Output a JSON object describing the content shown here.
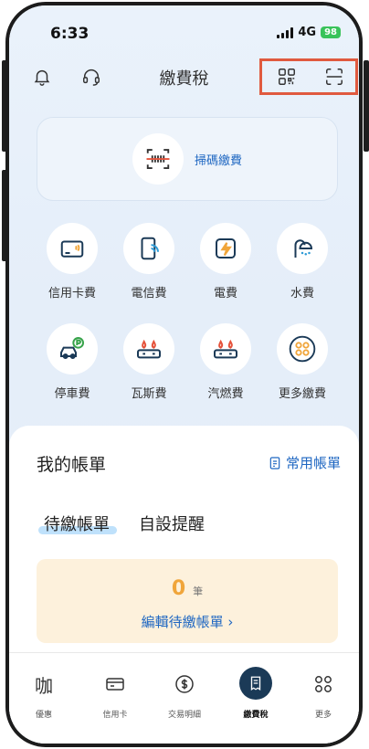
{
  "status_bar": {
    "time": "6:33",
    "network": "4G",
    "battery": "98"
  },
  "header": {
    "title": "繳費稅"
  },
  "scan_card": {
    "label": "掃碼繳費"
  },
  "services": [
    {
      "label": "信用卡費",
      "icon": "credit-card-icon"
    },
    {
      "label": "電信費",
      "icon": "phone-wifi-icon"
    },
    {
      "label": "電費",
      "icon": "lightning-icon"
    },
    {
      "label": "水費",
      "icon": "shower-icon"
    },
    {
      "label": "停車費",
      "icon": "parking-car-icon"
    },
    {
      "label": "瓦斯費",
      "icon": "gas-stove-icon"
    },
    {
      "label": "汽燃費",
      "icon": "fuel-stove-icon"
    },
    {
      "label": "更多繳費",
      "icon": "more-grid-icon"
    }
  ],
  "my_bills": {
    "title": "我的帳單",
    "frequent_link": "常用帳單",
    "tabs": [
      "待繳帳單",
      "自設提醒"
    ],
    "pending": {
      "count": "0",
      "unit": "筆",
      "edit_link": "編輯待繳帳單 ›"
    }
  },
  "bottom_nav": [
    {
      "label": "優惠",
      "icon": "coffee-text-icon",
      "glyph": "咖"
    },
    {
      "label": "信用卡",
      "icon": "credit-card-icon"
    },
    {
      "label": "交易明細",
      "icon": "dollar-circle-icon"
    },
    {
      "label": "繳費稅",
      "icon": "receipt-icon",
      "active": true
    },
    {
      "label": "更多",
      "icon": "four-circles-icon"
    }
  ],
  "colors": {
    "accent": "#1f67c2",
    "highlight_box": "#e05a3f",
    "pending_count": "#f0a53a",
    "active_nav": "#1b3a57",
    "service_icon": "#1b3a57",
    "flame_red": "#e5533c"
  }
}
